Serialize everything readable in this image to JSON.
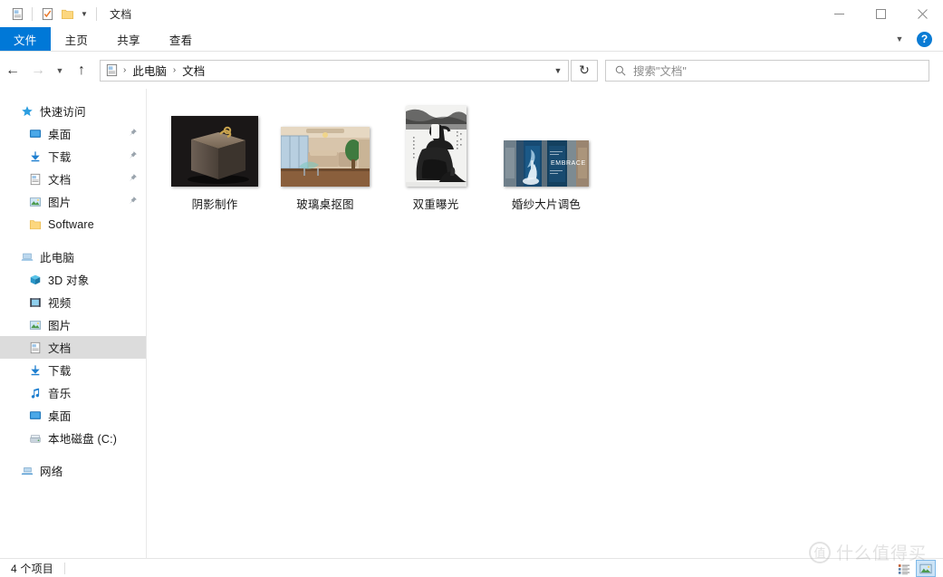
{
  "window": {
    "title": "文档",
    "quick_access_toolbar": [
      {
        "name": "properties-icon",
        "label": "属性"
      },
      {
        "name": "new-folder-checkbox-icon",
        "label": "新建文件夹"
      },
      {
        "name": "folder-icon",
        "label": "文件夹"
      },
      {
        "name": "customize-chevron-icon",
        "label": "自定义快速访问工具栏"
      }
    ],
    "controls": {
      "minimize": "—",
      "maximize": "□",
      "close": "✕"
    }
  },
  "ribbon": {
    "tabs": [
      {
        "label": "文件",
        "active_file_menu": true
      },
      {
        "label": "主页",
        "active_file_menu": false
      },
      {
        "label": "共享",
        "active_file_menu": false
      },
      {
        "label": "查看",
        "active_file_menu": false
      }
    ],
    "expand_chevron": "⌄",
    "help_label": "?",
    "accent_color": "#0078d7"
  },
  "navigation": {
    "back": "←",
    "forward": "→",
    "recent_chevron": "⌄",
    "up": "↑",
    "breadcrumb": {
      "root_icon": "documents-icon",
      "items": [
        "此电脑",
        "文档"
      ],
      "separator": "›",
      "dropdown_chevron": "⌄"
    },
    "refresh": "↻"
  },
  "search": {
    "icon": "search-icon",
    "placeholder": "搜索\"文档\""
  },
  "sidebar": {
    "groups": [
      {
        "header": {
          "label": "快速访问",
          "icon": "star-icon"
        },
        "items": [
          {
            "label": "桌面",
            "icon": "desktop-icon",
            "pinned": true,
            "selected": false
          },
          {
            "label": "下载",
            "icon": "downloads-icon",
            "pinned": true,
            "selected": false
          },
          {
            "label": "文档",
            "icon": "documents-icon",
            "pinned": true,
            "selected": false
          },
          {
            "label": "图片",
            "icon": "pictures-icon",
            "pinned": true,
            "selected": false
          },
          {
            "label": "Software",
            "icon": "folder-icon",
            "pinned": false,
            "selected": false
          }
        ]
      },
      {
        "header": {
          "label": "此电脑",
          "icon": "this-pc-icon"
        },
        "items": [
          {
            "label": "3D 对象",
            "icon": "3d-objects-icon",
            "pinned": false,
            "selected": false
          },
          {
            "label": "视频",
            "icon": "videos-icon",
            "pinned": false,
            "selected": false
          },
          {
            "label": "图片",
            "icon": "pictures-icon",
            "pinned": false,
            "selected": false
          },
          {
            "label": "文档",
            "icon": "documents-icon",
            "pinned": false,
            "selected": true
          },
          {
            "label": "下载",
            "icon": "downloads-icon",
            "pinned": false,
            "selected": false
          },
          {
            "label": "音乐",
            "icon": "music-icon",
            "pinned": false,
            "selected": false
          },
          {
            "label": "桌面",
            "icon": "desktop-icon",
            "pinned": false,
            "selected": false
          },
          {
            "label": "本地磁盘 (C:)",
            "icon": "local-disk-icon",
            "pinned": false,
            "selected": false
          }
        ]
      },
      {
        "header": {
          "label": "网络",
          "icon": "network-icon"
        },
        "items": []
      }
    ]
  },
  "files": [
    {
      "label": "阴影制作",
      "thumb_w": 96,
      "thumb_h": 78,
      "kind": "dark-box-photo"
    },
    {
      "label": "玻璃桌抠图",
      "thumb_w": 98,
      "thumb_h": 66,
      "kind": "living-room-photo"
    },
    {
      "label": "双重曝光",
      "thumb_w": 67,
      "thumb_h": 89,
      "kind": "double-exposure-photo"
    },
    {
      "label": "婚纱大片调色",
      "thumb_w": 94,
      "thumb_h": 51,
      "kind": "wedding-blue-photo"
    }
  ],
  "status": {
    "item_count": "4 个项目",
    "view_buttons": [
      {
        "name": "details-view-button",
        "active": false
      },
      {
        "name": "large-icons-view-button",
        "active": true
      }
    ]
  },
  "watermark": {
    "mark": "值",
    "text": "什么值得买"
  }
}
